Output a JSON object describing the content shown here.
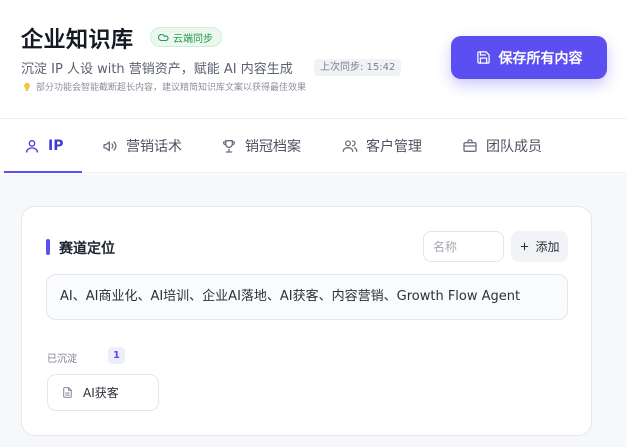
{
  "header": {
    "title": "企业知识库",
    "cloud_badge": "云端同步",
    "subtitle": "沉淀 IP 人设 with 营销资产，赋能 AI 内容生成",
    "last_sync": "上次同步: 15:42",
    "tip": "部分功能会智能截断超长内容，建议精简知识库文案以获得最佳效果",
    "save_button": "保存所有内容"
  },
  "tabs": [
    {
      "label": "IP",
      "icon": "user-icon",
      "active": true
    },
    {
      "label": "营销话术",
      "icon": "megaphone-icon",
      "active": false
    },
    {
      "label": "销冠档案",
      "icon": "trophy-icon",
      "active": false
    },
    {
      "label": "客户管理",
      "icon": "users-icon",
      "active": false
    },
    {
      "label": "团队成员",
      "icon": "briefcase-icon",
      "active": false
    }
  ],
  "card": {
    "title": "赛道定位",
    "name_placeholder": "名称",
    "add_button": "添加",
    "tags_value": "AI、AI商业化、AI培训、企业AI落地、AI获客、内容营销、Growth Flow Agent",
    "deposit_label": "已沉淀",
    "deposit_count": "1",
    "items": [
      {
        "label": "AI获客",
        "icon": "document-icon"
      }
    ]
  },
  "colors": {
    "accent": "#5b4ff2",
    "badge_green": "#1e9a4b",
    "background": "#f7f8fa"
  }
}
